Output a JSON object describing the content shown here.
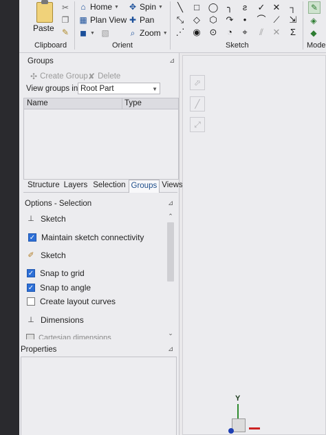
{
  "ribbon": {
    "clipboard": {
      "paste_label": "Paste",
      "group_label": "Clipboard"
    },
    "orient": {
      "home_label": "Home",
      "plan_view_label": "Plan View",
      "spin_label": "Spin",
      "pan_label": "Pan",
      "zoom_label": "Zoom",
      "group_label": "Orient"
    },
    "sketch": {
      "group_label": "Sketch"
    },
    "model": {
      "group_label": "Mode"
    }
  },
  "groups_panel": {
    "title": "Groups",
    "create_group_label": "Create Group",
    "delete_label": "Delete",
    "view_groups_label": "View groups in:",
    "view_groups_value": "Root Part",
    "columns": [
      "Name",
      "Type"
    ]
  },
  "tabs": [
    {
      "label": "Structure"
    },
    {
      "label": "Layers"
    },
    {
      "label": "Selection"
    },
    {
      "label": "Groups",
      "active": true
    },
    {
      "label": "Views"
    }
  ],
  "options": {
    "title": "Options - Selection",
    "sections": [
      {
        "label": "Sketch"
      },
      {
        "label": "Sketch"
      },
      {
        "label": "Dimensions"
      }
    ],
    "checks": [
      {
        "label": "Maintain sketch connectivity",
        "checked": true
      },
      {
        "label": "Snap to grid",
        "checked": true
      },
      {
        "label": "Snap to angle",
        "checked": true
      },
      {
        "label": "Create layout curves",
        "checked": false
      }
    ],
    "cut_off_label": "Cartesian dimensions"
  },
  "properties": {
    "title": "Properties"
  },
  "viewport": {
    "triad_y_label": "Y"
  },
  "colors": {
    "check_blue": "#2d6fd6",
    "accent_blue": "#1d4d8a",
    "axis_red": "#cc2222",
    "axis_green": "#2e8b2e"
  }
}
